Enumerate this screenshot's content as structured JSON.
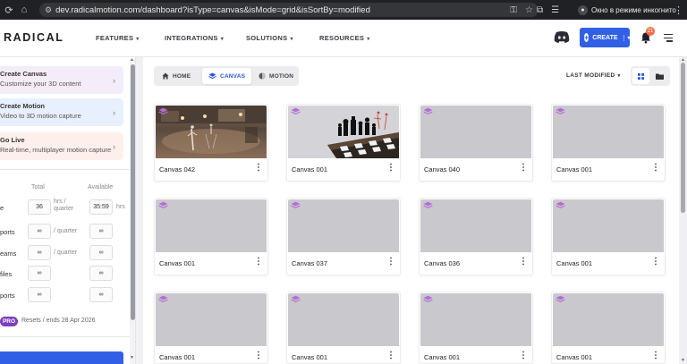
{
  "browser": {
    "url": "dev.radicalmotion.com/dashboard?isType=canvas&isMode=grid&isSortBy=modified",
    "incognito_label": "Окно в режиме инкогнито"
  },
  "header": {
    "logo": "RADICAL",
    "nav": [
      "FEATURES",
      "INTEGRATIONS",
      "SOLUTIONS",
      "RESOURCES"
    ],
    "create_label": "CREATE",
    "notification_count": "21",
    "colors": {
      "accent": "#3160e6",
      "badge": "#f36b4a"
    }
  },
  "sidebar": {
    "actions": [
      {
        "title": "Create Canvas",
        "subtitle": "Customize your 3D content",
        "color": "#f5ecfa"
      },
      {
        "title": "Create Motion",
        "subtitle": "Video to 3D motion capture",
        "color": "#e8f0fd"
      },
      {
        "title": "Go Live",
        "subtitle": "Real-time, multiplayer motion capture",
        "color": "#fdf0ec"
      }
    ],
    "usage": {
      "col_total": "Total",
      "col_available": "Available",
      "rows": [
        {
          "label": "e",
          "total": "36",
          "unit": "hrs / quarter",
          "available": "35:59",
          "avail_unit": "hrs"
        },
        {
          "label": "ports",
          "total": "∞",
          "unit": "/ quarter",
          "available": "∞",
          "avail_unit": ""
        },
        {
          "label": "eams",
          "total": "∞",
          "unit": "/ quarter",
          "available": "∞",
          "avail_unit": ""
        },
        {
          "label": "files",
          "total": "∞",
          "unit": "",
          "available": "∞",
          "avail_unit": ""
        },
        {
          "label": "ports",
          "total": "∞",
          "unit": "",
          "available": "∞",
          "avail_unit": ""
        }
      ]
    },
    "plan_badge": "PRO",
    "resets_text": "Resets / ends 28 Apr 2026"
  },
  "main": {
    "tabs": [
      {
        "label": "HOME",
        "icon": "home-icon"
      },
      {
        "label": "CANVAS",
        "icon": "layers-icon"
      },
      {
        "label": "MOTION",
        "icon": "motion-icon"
      }
    ],
    "active_tab": "CANVAS",
    "sort_label": "LAST MODIFIED",
    "view_mode": "grid",
    "layer_icon_color": "#b46cd8",
    "cards": [
      {
        "name": "Canvas 042",
        "thumbnail": "street-scene"
      },
      {
        "name": "Canvas 001",
        "thumbnail": "chess-scene"
      },
      {
        "name": "Canvas 040",
        "thumbnail": "blank"
      },
      {
        "name": "Canvas 001",
        "thumbnail": "blank"
      },
      {
        "name": "Canvas 001",
        "thumbnail": "blank"
      },
      {
        "name": "Canvas 037",
        "thumbnail": "blank"
      },
      {
        "name": "Canvas 036",
        "thumbnail": "blank"
      },
      {
        "name": "Canvas 001",
        "thumbnail": "blank"
      },
      {
        "name": "Canvas 001",
        "thumbnail": "blank"
      },
      {
        "name": "Canvas 001",
        "thumbnail": "blank"
      },
      {
        "name": "Canvas 001",
        "thumbnail": "blank"
      },
      {
        "name": "Canvas 001",
        "thumbnail": "blank"
      }
    ]
  }
}
